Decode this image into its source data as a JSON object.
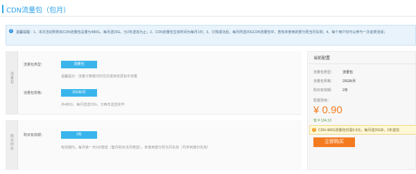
{
  "page": {
    "title": "CDN流量包（包月）"
  },
  "notice": {
    "text": "温馨提醒：1、本次活动所购买CDN流量包总量为480G，每月送20G，分2年送完为止；2、CDN流量包生效时间为每月1日；3、订购成功后，每月所送20GCDN流量包中，若有未使用的部分则当月失效；4、每个用户仅可以参与一次此类活动；"
  },
  "spec_section": {
    "side_label": "流量包",
    "type_label": "流量包类型：",
    "type_value": "流量包",
    "type_hint": "温馨提示：流量计算模式时优先抵用资源包中流量",
    "size_label": "流量包规格：",
    "size_value": "20GB/月",
    "size_hint": "共480G，每月送送20G，分两年送送完毕"
  },
  "time_section": {
    "side_label": "购买时长",
    "duration_label": "购买有效期：",
    "duration_value": "2年",
    "duration_hint": "有效期内，每月第一天0点赠送（套月购买当月赠送），未使用部分则当月失效（月末到期日失效）"
  },
  "summary": {
    "title": "当前配置",
    "rows": [
      {
        "label": "流量包类型：",
        "value": "流量包"
      },
      {
        "label": "流量包规格：",
        "value": "20GB/月"
      },
      {
        "label": "购买有效期：",
        "value": "2年"
      }
    ],
    "price_label": "配置费用：",
    "price": "¥ 0.90",
    "saving": "省 ¥ 134.10",
    "tip": "CDN 480G流量包仅需0.9元，每月送20GB，2年送完",
    "buy_label": "立即购买"
  },
  "colors": {
    "accent_blue": "#2ba5e8",
    "select_blue": "#3ab5ec",
    "price_orange": "#f47b20",
    "notice_bg": "#e9f3fb",
    "tip_bg": "#fff8d6"
  },
  "icons": {
    "notice": "info-icon",
    "tip": "warning-icon"
  }
}
